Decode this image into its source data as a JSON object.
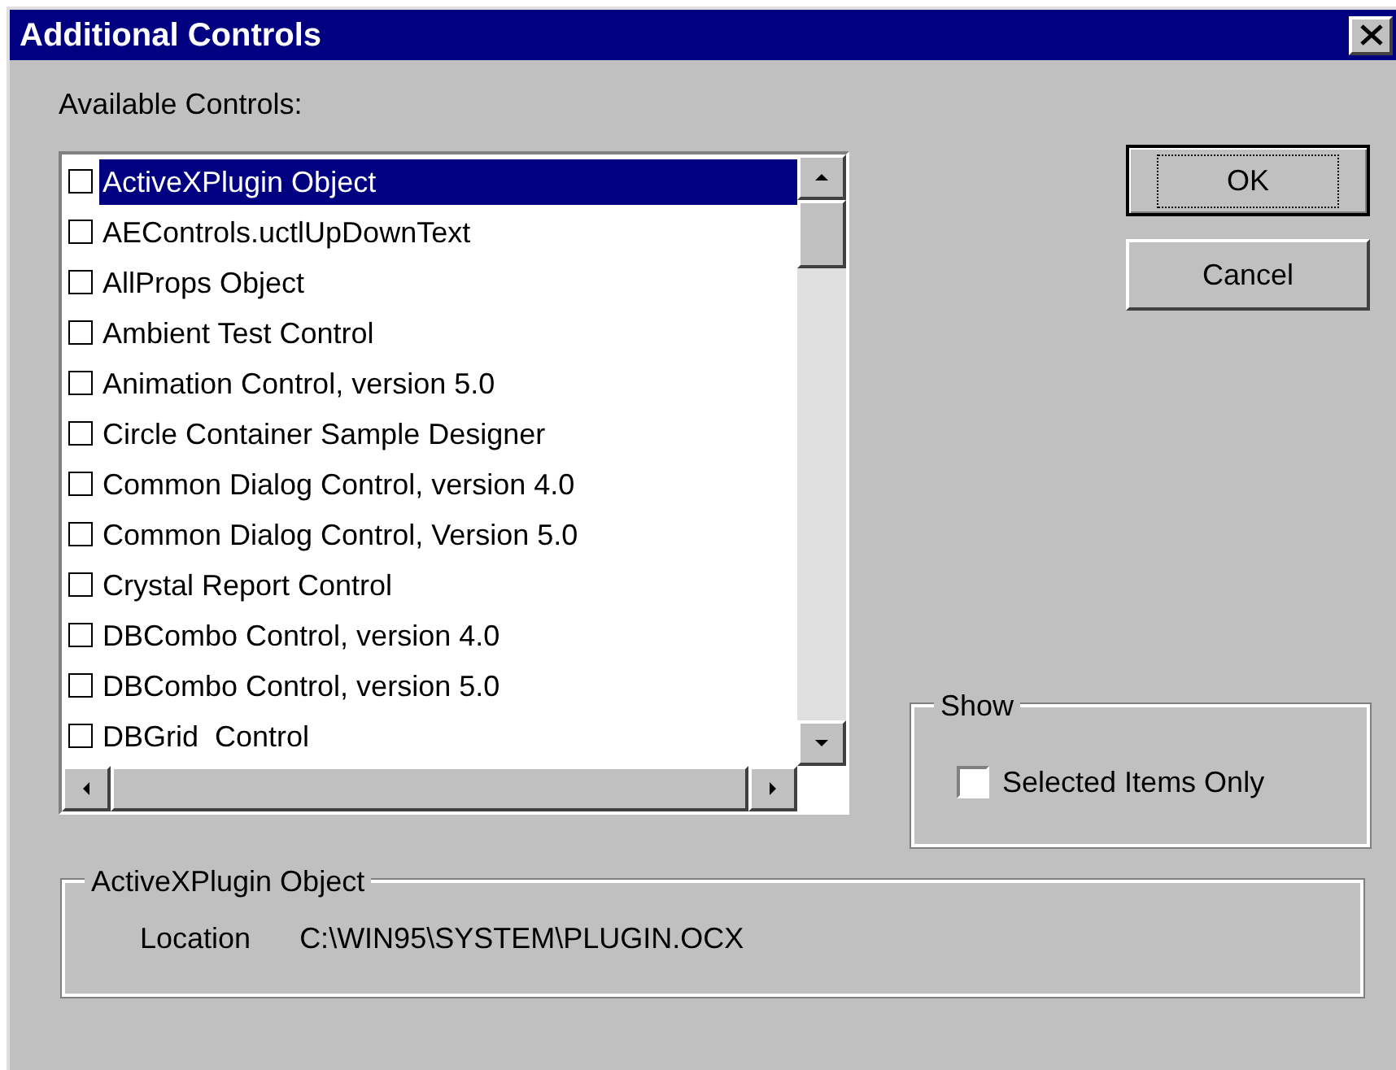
{
  "window": {
    "title": "Additional Controls"
  },
  "available_controls": {
    "label": "Available Controls:",
    "items": [
      {
        "label": "ActiveXPlugin Object",
        "checked": false,
        "selected": true
      },
      {
        "label": "AEControls.uctlUpDownText",
        "checked": false,
        "selected": false
      },
      {
        "label": "AllProps Object",
        "checked": false,
        "selected": false
      },
      {
        "label": "Ambient Test Control",
        "checked": false,
        "selected": false
      },
      {
        "label": "Animation Control, version 5.0",
        "checked": false,
        "selected": false
      },
      {
        "label": "Circle Container Sample Designer",
        "checked": false,
        "selected": false
      },
      {
        "label": "Common Dialog Control, version 4.0",
        "checked": false,
        "selected": false
      },
      {
        "label": "Common Dialog Control, Version 5.0",
        "checked": false,
        "selected": false
      },
      {
        "label": "Crystal Report Control",
        "checked": false,
        "selected": false
      },
      {
        "label": "DBCombo Control, version 4.0",
        "checked": false,
        "selected": false
      },
      {
        "label": "DBCombo Control, version 5.0",
        "checked": false,
        "selected": false
      },
      {
        "label": "DBGrid  Control",
        "checked": false,
        "selected": false
      }
    ]
  },
  "buttons": [
    {
      "label": "OK",
      "default": true
    },
    {
      "label": "Cancel",
      "default": false
    }
  ],
  "show": {
    "title": "Show",
    "option": {
      "label": "Selected Items Only",
      "checked": false
    }
  },
  "details": {
    "title": "ActiveXPlugin Object",
    "location_label": "Location",
    "location": "C:\\WIN95\\SYSTEM\\PLUGIN.OCX"
  }
}
